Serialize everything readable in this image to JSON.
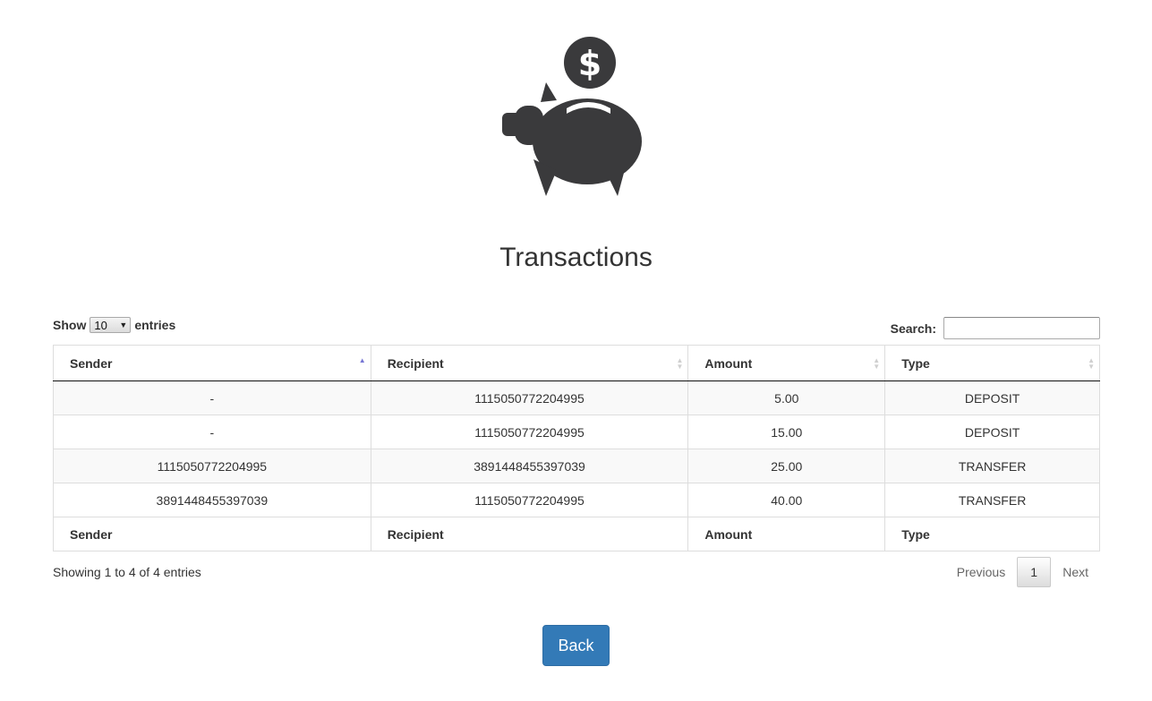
{
  "page": {
    "title": "Transactions",
    "logo_icon": "piggy-bank-dollar-icon"
  },
  "length": {
    "show_label": "Show",
    "value": "10",
    "entries_label": "entries"
  },
  "search": {
    "label": "Search:",
    "value": ""
  },
  "table": {
    "headers": [
      "Sender",
      "Recipient",
      "Amount",
      "Type"
    ],
    "sorted_column": "Sender",
    "sort_direction": "ascending",
    "rows": [
      [
        "-",
        "1115050772204995",
        "5.00",
        "DEPOSIT"
      ],
      [
        "-",
        "1115050772204995",
        "15.00",
        "DEPOSIT"
      ],
      [
        "1115050772204995",
        "3891448455397039",
        "25.00",
        "TRANSFER"
      ],
      [
        "3891448455397039",
        "1115050772204995",
        "40.00",
        "TRANSFER"
      ]
    ],
    "footers": [
      "Sender",
      "Recipient",
      "Amount",
      "Type"
    ]
  },
  "info": "Showing 1 to 4 of 4 entries",
  "pagination": {
    "previous": "Previous",
    "current": "1",
    "next": "Next"
  },
  "back_label": "Back",
  "colors": {
    "icon": "#3a3a3c",
    "button": "#337ab7",
    "sort_active": "#7676d4"
  }
}
